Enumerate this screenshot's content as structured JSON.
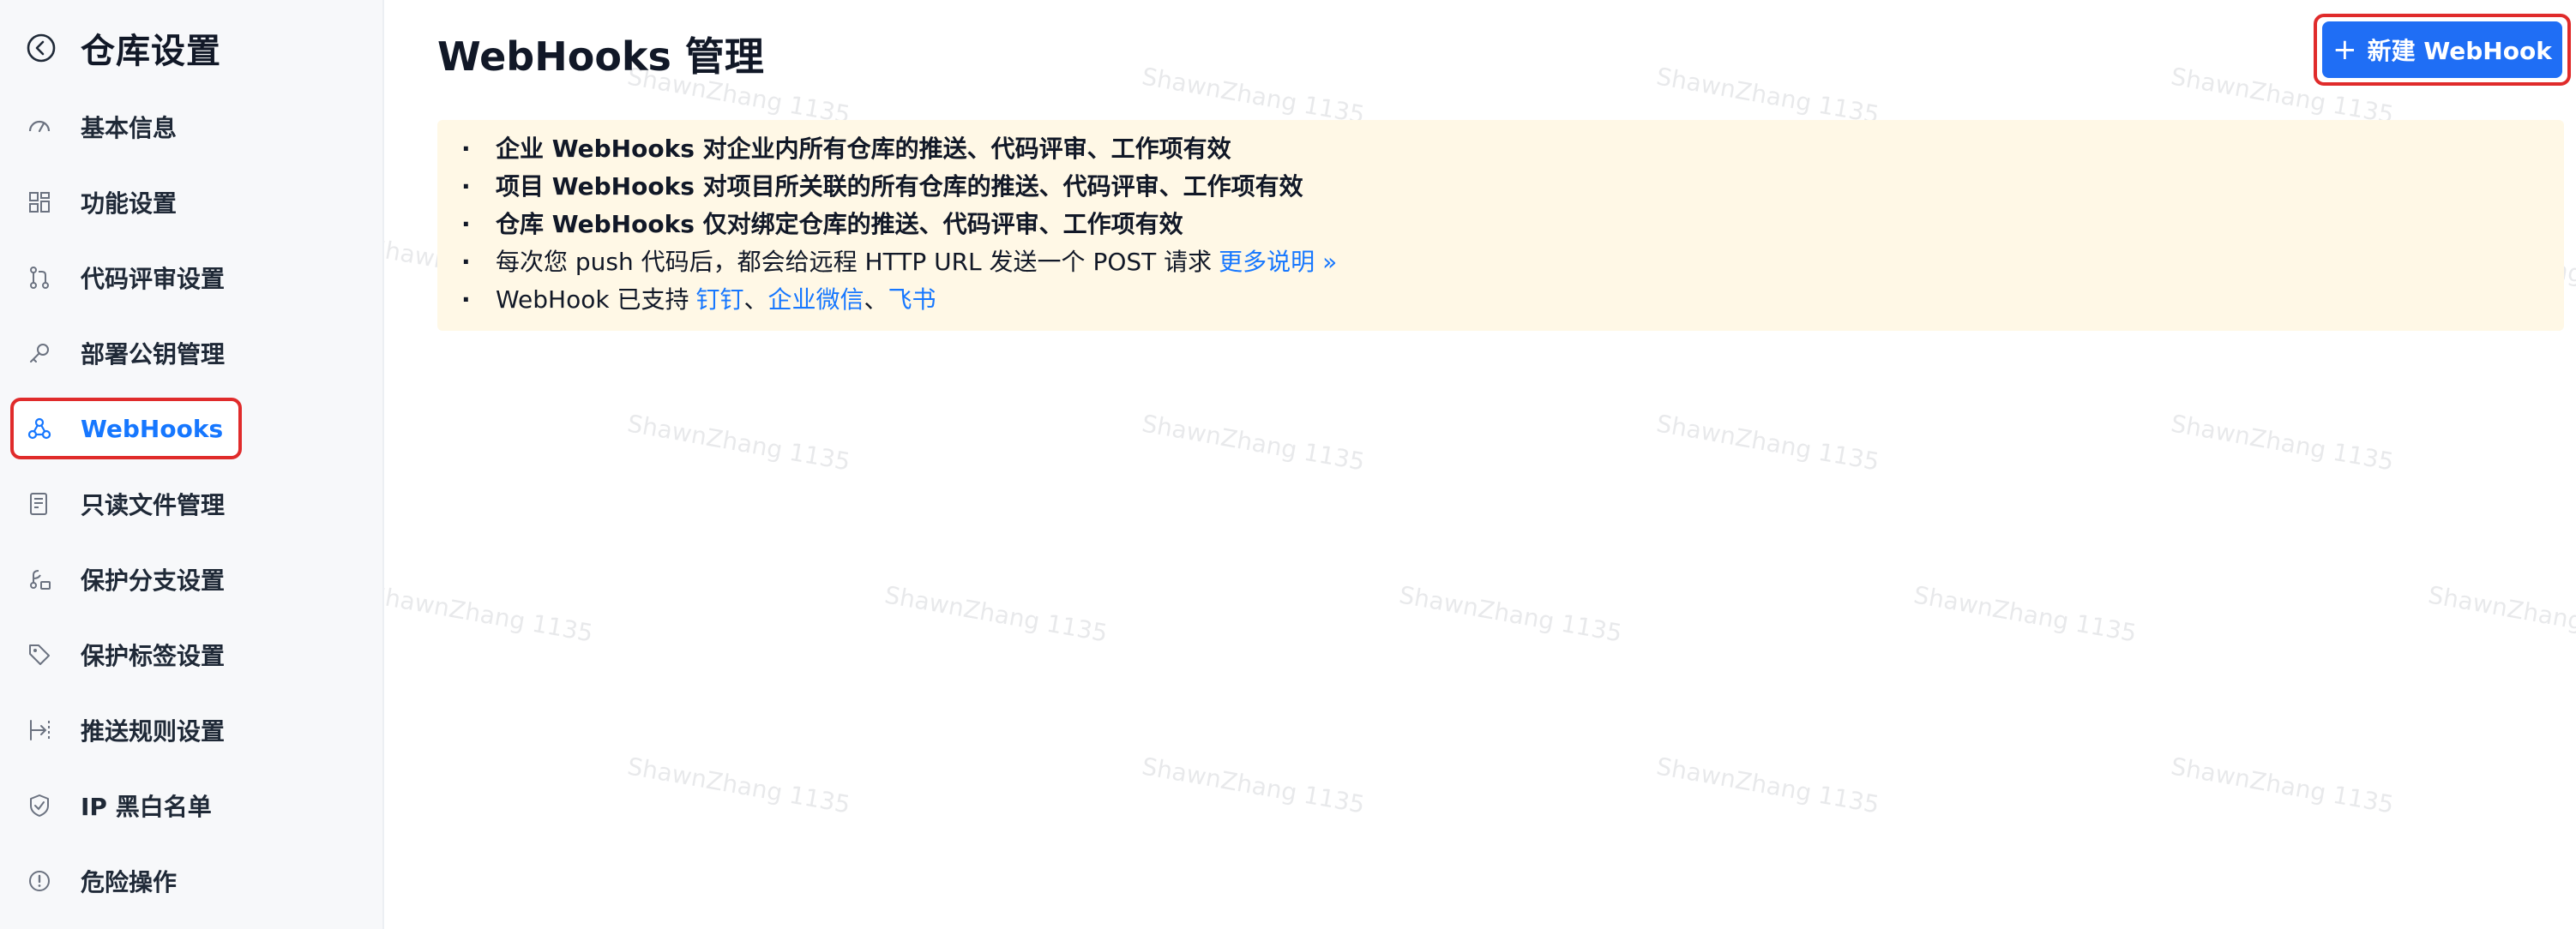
{
  "sidebar": {
    "title": "仓库设置",
    "items": [
      {
        "label": "基本信息",
        "icon": "speedometer-icon"
      },
      {
        "label": "功能设置",
        "icon": "grid-icon"
      },
      {
        "label": "代码评审设置",
        "icon": "merge-request-icon"
      },
      {
        "label": "部署公钥管理",
        "icon": "key-icon"
      },
      {
        "label": "WebHooks",
        "icon": "webhook-icon",
        "active": true
      },
      {
        "label": "只读文件管理",
        "icon": "file-list-icon"
      },
      {
        "label": "保护分支设置",
        "icon": "protected-branch-icon"
      },
      {
        "label": "保护标签设置",
        "icon": "tag-icon"
      },
      {
        "label": "推送规则设置",
        "icon": "push-rule-icon"
      },
      {
        "label": "IP 黑白名单",
        "icon": "shield-check-icon"
      },
      {
        "label": "危险操作",
        "icon": "alert-circle-icon"
      }
    ]
  },
  "main": {
    "title": "WebHooks 管理",
    "new_button": {
      "plus": "+",
      "label": "新建 WebHook"
    },
    "notice": {
      "line1": "企业 WebHooks 对企业内所有仓库的推送、代码评审、工作项有效",
      "line2": "项目 WebHooks 对项目所关联的所有仓库的推送、代码评审、工作项有效",
      "line3": "仓库 WebHooks 仅对绑定仓库的推送、代码评审、工作项有效",
      "line4_text": "每次您 push 代码后，都会给远程 HTTP URL 发送一个 POST 请求",
      "line4_link": "更多说明 »",
      "line5_prefix": "WebHook 已支持",
      "link_dingtalk": "钉钉",
      "sep1": "、",
      "link_wecom": "企业微信",
      "sep2": "、",
      "link_feishu": "飞书"
    }
  },
  "watermark": "ShawnZhang 1135",
  "colors": {
    "accent": "#1677ff",
    "button": "#1f6ef5",
    "highlight_border": "#e02b2b",
    "notice_bg": "#fff8e6",
    "sidebar_bg": "#f7f8fa"
  }
}
